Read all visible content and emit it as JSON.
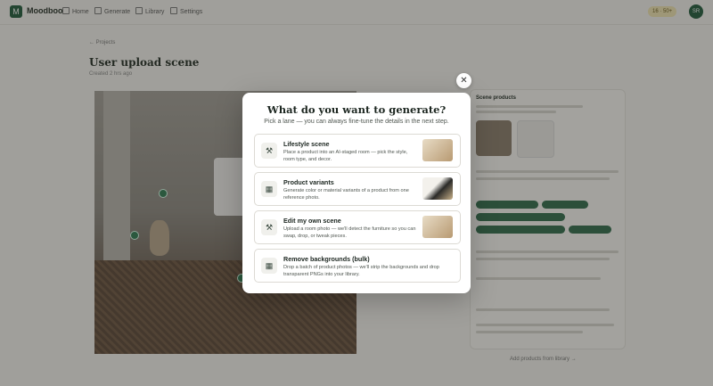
{
  "app": {
    "brand": "Moodboo",
    "logo_letter": "M"
  },
  "nav": [
    {
      "label": "Home"
    },
    {
      "label": "Generate"
    },
    {
      "label": "Library"
    },
    {
      "label": "Settings"
    }
  ],
  "header": {
    "credits": "16 · 50+",
    "avatar": "SR"
  },
  "page": {
    "back": "← Projects",
    "title": "User upload scene",
    "subtitle": "Created 2 hrs ago"
  },
  "right_panel": {
    "heading": "Scene products",
    "footer_link": "Add products from library →"
  },
  "modal": {
    "close_icon": "close-icon",
    "title": "What do you want to generate?",
    "subtitle": "Pick a lane — you can always fine-tune the details in the next step.",
    "options": [
      {
        "title": "Lifestyle scene",
        "description": "Place a product into an AI-staged room — pick the style, room type, and decor.",
        "icon": "wand-icon"
      },
      {
        "title": "Product variants",
        "description": "Generate color or material variants of a product from one reference photo.",
        "icon": "grid-icon"
      },
      {
        "title": "Edit my own scene",
        "description": "Upload a room photo — we'll detect the furniture so you can swap, drop, or tweak pieces.",
        "icon": "wand-icon"
      },
      {
        "title": "Remove backgrounds (bulk)",
        "description": "Drop a batch of product photos — we'll strip the backgrounds and drop transparent PNGs into your library.",
        "icon": "grid-icon"
      }
    ]
  }
}
